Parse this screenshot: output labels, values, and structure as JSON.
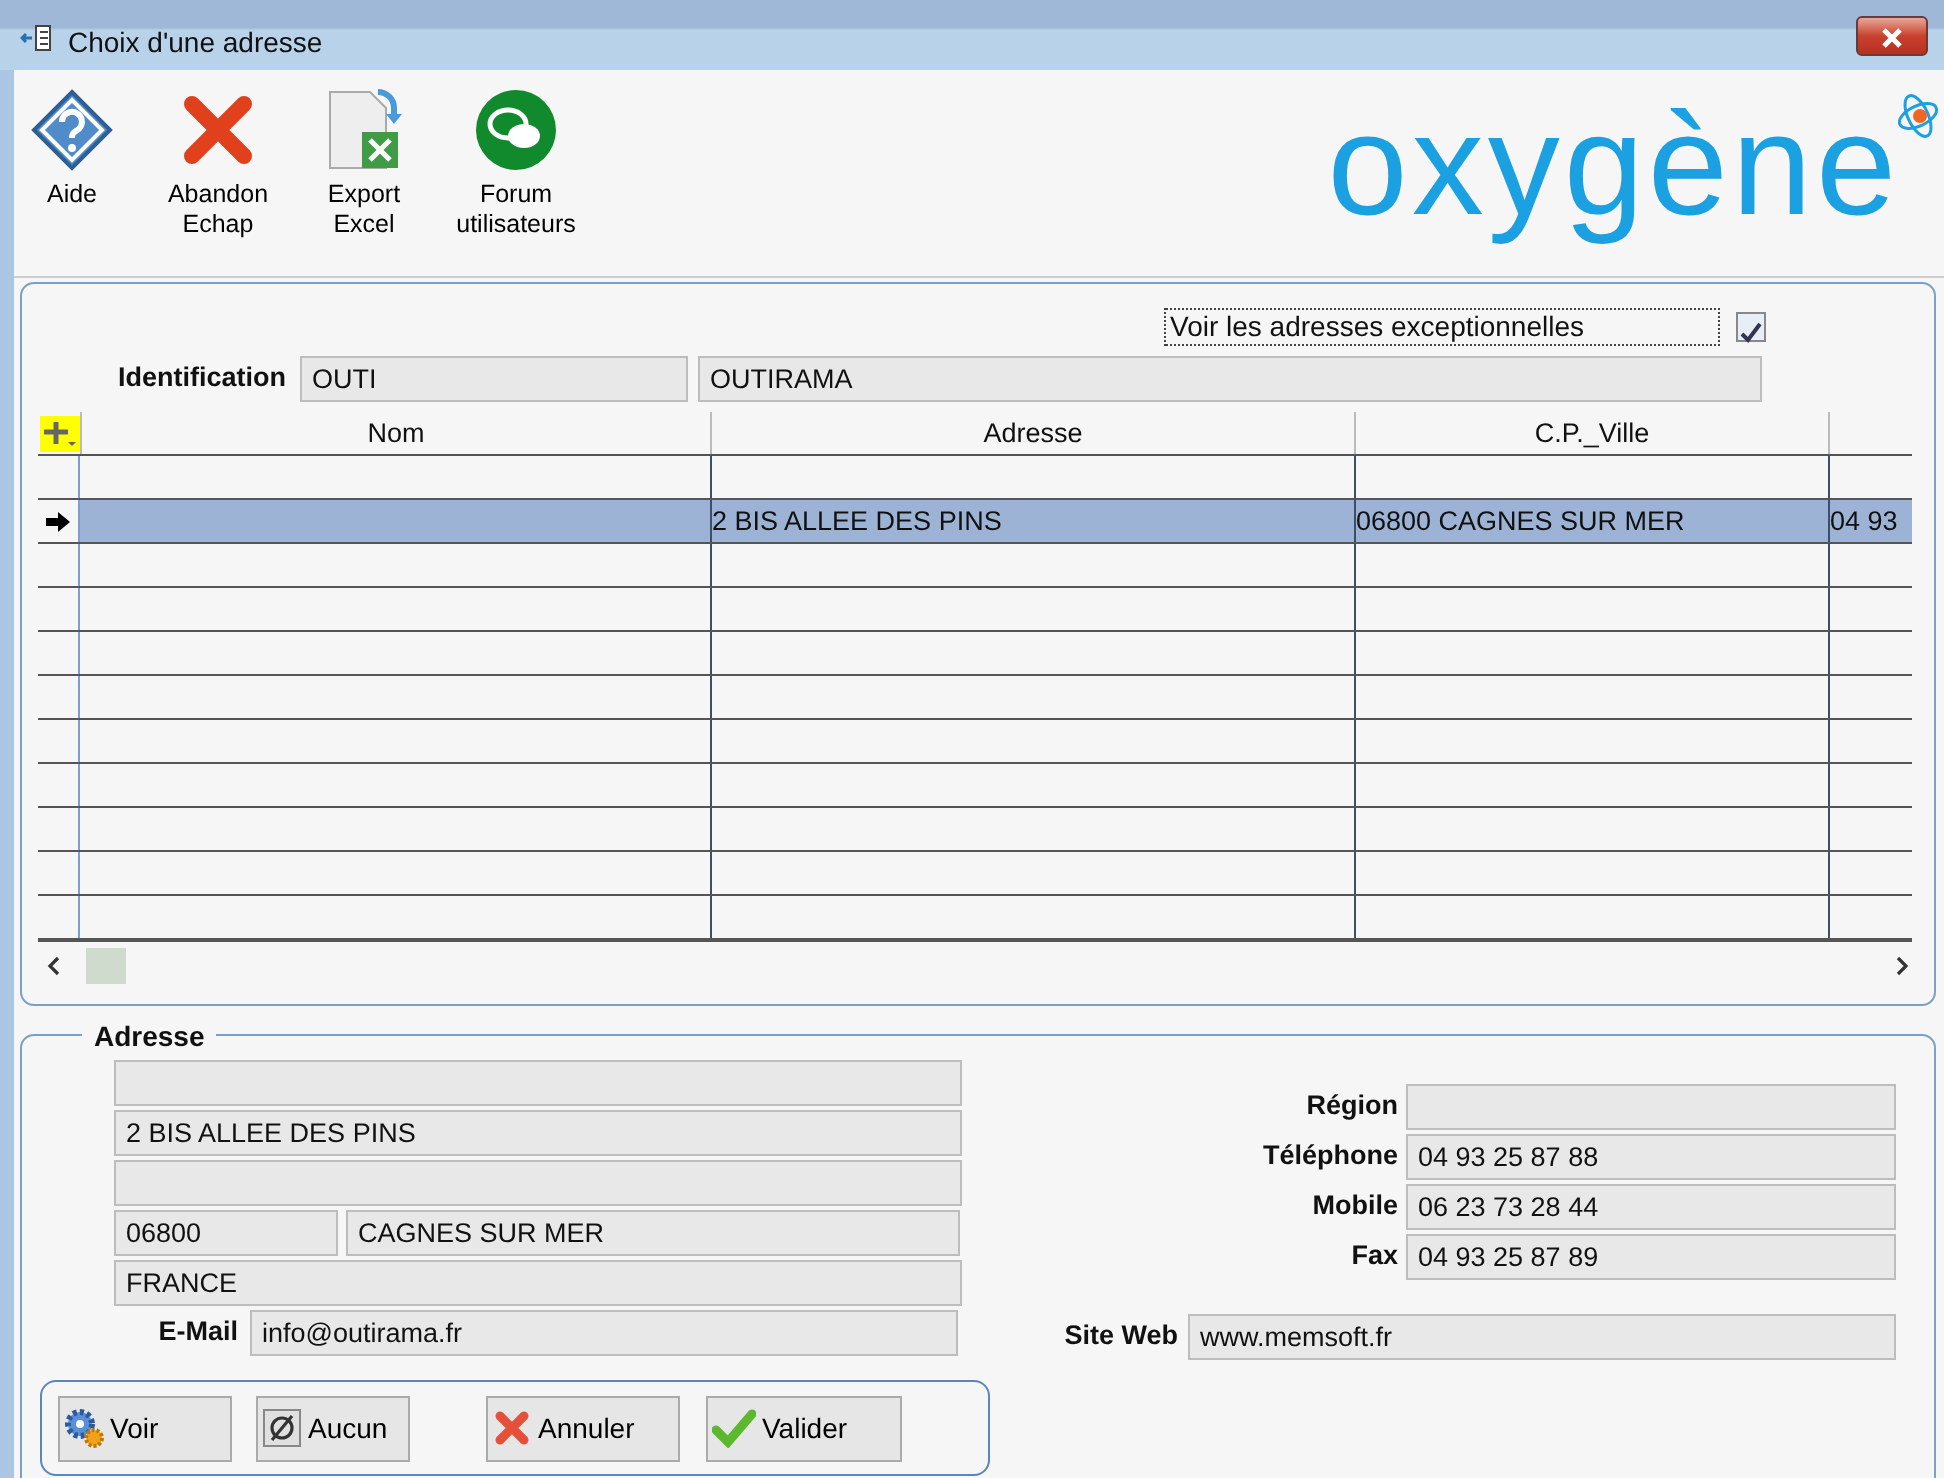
{
  "window": {
    "title": "Choix d'une adresse"
  },
  "toolbar": [
    {
      "kind": "help",
      "label": "Aide"
    },
    {
      "kind": "cancel",
      "label": "Abandon\nEchap"
    },
    {
      "kind": "excel",
      "label": "Export\nExcel"
    },
    {
      "kind": "forum",
      "label": "Forum\nutilisateurs"
    }
  ],
  "logo": {
    "text": "oxygène"
  },
  "show_exceptional": {
    "label": "Voir les adresses exceptionnelles",
    "checked": true
  },
  "identification": {
    "label": "Identification",
    "code": "OUTI",
    "name": "OUTIRAMA"
  },
  "table": {
    "columns": [
      "Nom",
      "Adresse",
      "C.P._Ville"
    ],
    "rows": [
      {
        "selected": false
      },
      {
        "selected": true,
        "adresse": "2 BIS ALLEE DES PINS",
        "cp_ville": "06800 CAGNES SUR MER",
        "column_4": "04 93"
      },
      {
        "selected": false
      },
      {
        "selected": false
      },
      {
        "selected": false
      },
      {
        "selected": false
      },
      {
        "selected": false
      },
      {
        "selected": false
      },
      {
        "selected": false
      },
      {
        "selected": false
      },
      {
        "selected": false
      }
    ]
  },
  "adresse": {
    "title": "Adresse",
    "lines": [
      {
        "kind": "empty"
      },
      {
        "kind": "text",
        "value": "2 BIS ALLEE DES PINS"
      },
      {
        "kind": "empty"
      }
    ],
    "postal_code": "06800",
    "city": "CAGNES SUR MER",
    "country": "FRANCE",
    "email": {
      "label": "E-Mail",
      "value": "info@outirama.fr"
    },
    "contacts": [
      {
        "label": "Région"
      },
      {
        "label": "Téléphone",
        "value": "04 93 25 87 88"
      },
      {
        "label": "Mobile",
        "value": "06 23 73 28 44"
      },
      {
        "label": "Fax",
        "value": "04 93 25 87 89"
      }
    ],
    "website": {
      "label": "Site Web",
      "value": "www.memsoft.fr"
    }
  },
  "buttons": [
    {
      "kind": "view",
      "label": "Voir"
    },
    {
      "kind": "none",
      "label": "Aucun"
    },
    {
      "kind": "cancel",
      "label": "Annuler"
    },
    {
      "kind": "validate",
      "label": "Valider"
    }
  ]
}
